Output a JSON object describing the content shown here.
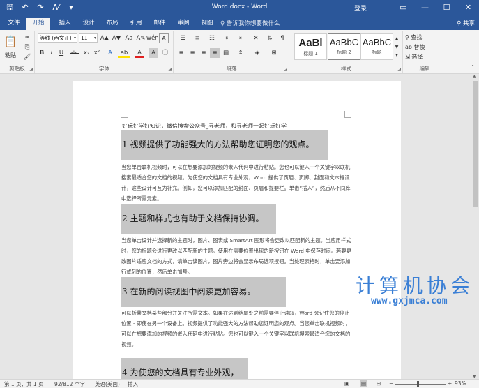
{
  "titlebar": {
    "title": "Word.docx - Word",
    "login": "登录",
    "qat": {
      "save": "🖫",
      "undo": "↶",
      "redo": "↷",
      "format": "A⁄",
      "more": "▾"
    },
    "controls": {
      "options": "▭",
      "minimize": "—",
      "maximize": "☐",
      "close": "✕"
    }
  },
  "tabs": {
    "items": [
      "文件",
      "开始",
      "插入",
      "设计",
      "布局",
      "引用",
      "邮件",
      "审阅",
      "视图"
    ],
    "active": "开始",
    "tell_me": "♀ 告诉我你想要做什么",
    "share": "⚲ 共享"
  },
  "ribbon": {
    "clipboard": {
      "label": "剪贴板",
      "paste": "粘贴"
    },
    "font": {
      "label": "字体",
      "font_name": "等线 (西文正)",
      "font_size": "11",
      "bold": "B",
      "italic": "I",
      "underline": "U",
      "strike": "abc",
      "subscript": "x₂",
      "superscript": "x²",
      "grow": "A▲",
      "shrink": "A▼",
      "case": "Aa",
      "clear": "A✎",
      "phonetic": "wén",
      "border": "A",
      "effects": "A",
      "highlight": "ab",
      "font_color": "A",
      "shading": "A",
      "circle": "㊀"
    },
    "paragraph": {
      "label": "段落"
    },
    "styles": {
      "label": "样式",
      "items": [
        {
          "sample": "AaBl",
          "name": "标题 1"
        },
        {
          "sample": "AaBbC",
          "name": "标题 2"
        },
        {
          "sample": "AaBbC",
          "name": "标题"
        }
      ]
    },
    "editing": {
      "label": "编辑",
      "find": "⚲ 查找",
      "replace": "ab 替换",
      "select": "⇲ 选择"
    }
  },
  "document": {
    "header_line": "好玩好学好知识，微信搜索公众号_寻老师，和寻老师一起好玩好学",
    "sections": [
      {
        "heading": "1 视频提供了功能强大的方法帮助您证明您的观点。",
        "body": "当您单击联机视频时，可以在想要添加的视频的嵌入代码中进行粘贴。您也可以键入一个关键字以联机搜索最适合您的文档的视频。为使您的文档具有专业外观，Word 提供了页眉、页脚、封面和文本框设计，这些设计可互为补充。例如，您可以添加匹配的封面、页眉和提要栏。单击“插入”，然后从不同库中选择所需元素。"
      },
      {
        "heading": "2 主题和样式也有助于文档保持协调。",
        "body": "当您单击设计并选择新的主题时，图片、图表或 SmartArt 图形将会更改以匹配新的主题。当应用样式时，您的标题会进行更改以匹配新的主题。使用在需要位置出现的新按钮在 Word 中保存时间。若要更改图片适应文档的方式，请单击该图片，图片旁边将会显示布局选项按钮。当处理表格时，单击要添加行或列的位置，然后单击加号。"
      },
      {
        "heading": "3 在新的阅读视图中阅读更加容易。",
        "body": "可以折叠文档某些部分并关注所需文本。如果在达到结尾处之前需要停止读取，Word 会记住您的停止位置 - 即使在另一个设备上。视频提供了功能强大的方法帮助您证明您的观点。当您单击联机视频时，可以在想要添加的视频的嵌入代码中进行粘贴。您也可以键入一个关键字以联机搜索最适合您的文档的视频。"
      },
      {
        "heading": "4 为使您的文档具有专业外观，",
        "body": ""
      }
    ]
  },
  "watermark": {
    "text": "计算机协会",
    "url": "www.gxjmca.com"
  },
  "statusbar": {
    "page": "第 1 页，共 1 页",
    "words": "92/812 个字",
    "language": "英语(美国)",
    "mode": "插入",
    "zoom_minus": "−",
    "zoom_plus": "+",
    "zoom": "93%"
  }
}
